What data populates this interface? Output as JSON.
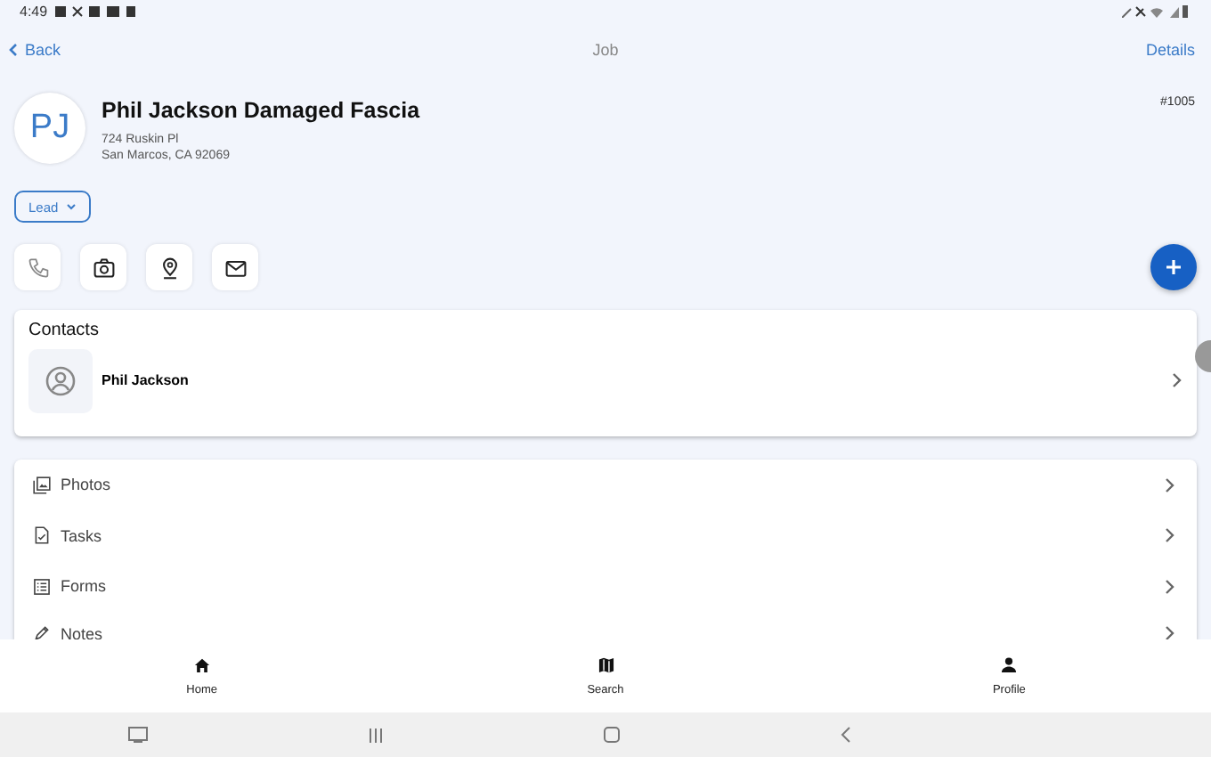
{
  "status_bar": {
    "time": "4:49"
  },
  "header": {
    "back": "Back",
    "title": "Job",
    "action": "Details"
  },
  "job": {
    "initials": "PJ",
    "title": "Phil Jackson Damaged Fascia",
    "address_line_1": "724 Ruskin Pl",
    "address_line_2": "San Marcos, CA 92069",
    "number": "#1005",
    "status": "Lead"
  },
  "actions": [
    {
      "kind": "phone"
    },
    {
      "kind": "camera"
    },
    {
      "kind": "location"
    },
    {
      "kind": "email"
    }
  ],
  "contacts": {
    "title": "Contacts",
    "items": [
      {
        "name": "Phil Jackson"
      }
    ]
  },
  "sections": [
    {
      "kind": "photos",
      "label": "Photos"
    },
    {
      "kind": "tasks",
      "label": "Tasks"
    },
    {
      "kind": "forms",
      "label": "Forms"
    },
    {
      "kind": "notes",
      "label": "Notes"
    }
  ],
  "bottom_nav": [
    {
      "kind": "home",
      "label": "Home"
    },
    {
      "kind": "map",
      "label": "Search"
    },
    {
      "kind": "person",
      "label": "Profile"
    }
  ]
}
